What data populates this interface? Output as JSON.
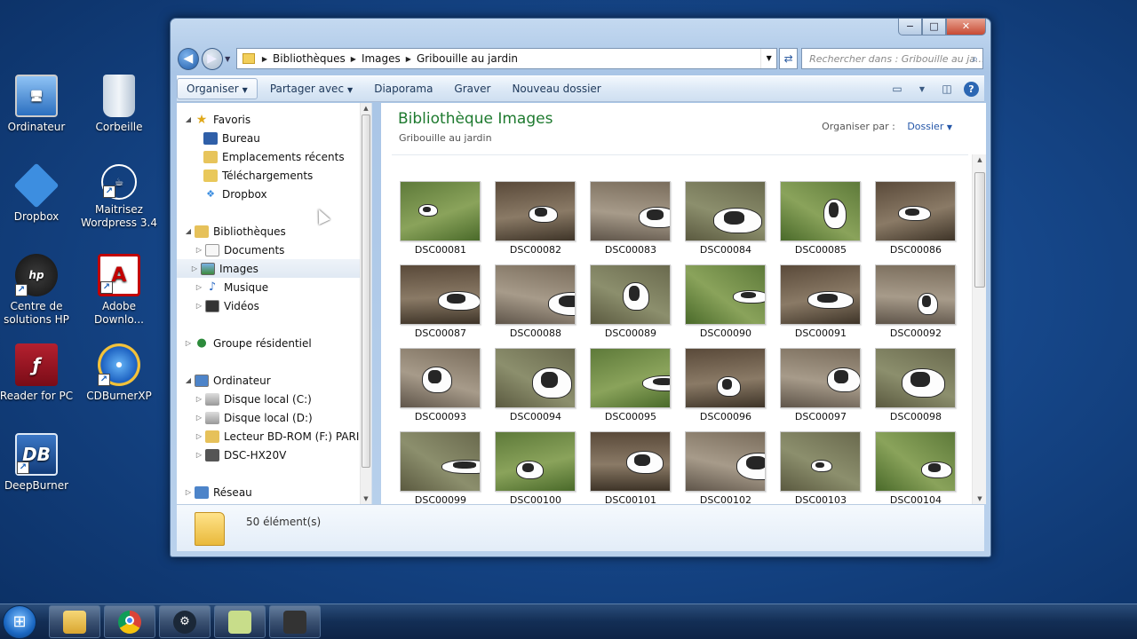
{
  "desktop": {
    "icons": [
      {
        "label": "Ordinateur",
        "icon": "computer-icon"
      },
      {
        "label": "Corbeille",
        "icon": "recycle-bin-icon"
      },
      {
        "label": "Dropbox",
        "icon": "dropbox-icon"
      },
      {
        "label": "Maitrisez Wordpress 3.4",
        "icon": "wordpress-book-icon"
      },
      {
        "label": "Centre de solutions HP",
        "icon": "hp-icon"
      },
      {
        "label": "Adobe Downlo...",
        "icon": "adobe-icon"
      },
      {
        "label": "Reader for PC",
        "icon": "reader-icon"
      },
      {
        "label": "CDBurnerXP",
        "icon": "cdburner-icon"
      },
      {
        "label": "DeepBurner",
        "icon": "deepburner-icon"
      }
    ]
  },
  "window": {
    "controls": {
      "minimize": "−",
      "maximize": "□",
      "close": "✕"
    },
    "breadcrumb": [
      "Bibliothèques",
      "Images",
      "Gribouille au jardin"
    ],
    "search_placeholder": "Rechercher dans : Gribouille au ja...",
    "toolbar": {
      "organize": "Organiser",
      "share": "Partager avec",
      "slideshow": "Diaporama",
      "burn": "Graver",
      "new_folder": "Nouveau dossier",
      "help": "?"
    },
    "navpane": {
      "favorites": "Favoris",
      "fav_items": [
        "Bureau",
        "Emplacements récents",
        "Téléchargements",
        "Dropbox"
      ],
      "libraries": "Bibliothèques",
      "lib_items": [
        "Documents",
        "Images",
        "Musique",
        "Vidéos"
      ],
      "homegroup": "Groupe résidentiel",
      "computer": "Ordinateur",
      "drives": [
        "Disque local (C:)",
        "Disque local (D:)",
        "Lecteur BD-ROM (F:) PARISIEN",
        "DSC-HX20V"
      ],
      "network": "Réseau"
    },
    "content": {
      "title": "Bibliothèque Images",
      "subtitle": "Gribouille au jardin",
      "arrange_label": "Organiser par :",
      "arrange_value": "Dossier",
      "files": [
        "DSC00081",
        "DSC00082",
        "DSC00083",
        "DSC00084",
        "DSC00085",
        "DSC00086",
        "DSC00087",
        "DSC00088",
        "DSC00089",
        "DSC00090",
        "DSC00091",
        "DSC00092",
        "DSC00093",
        "DSC00094",
        "DSC00095",
        "DSC00096",
        "DSC00097",
        "DSC00098",
        "DSC00099",
        "DSC00100",
        "DSC00101",
        "DSC00102",
        "DSC00103",
        "DSC00104"
      ]
    },
    "details": {
      "count": "50 élément(s)"
    }
  },
  "taskbar": {
    "apps": [
      "windows-explorer-icon",
      "chrome-icon",
      "steam-icon",
      "notes-icon",
      "camera-icon"
    ]
  },
  "colors": {
    "desktop_bg": "#16478a",
    "library_title": "#1e7a2f",
    "link_blue": "#2456a8"
  }
}
